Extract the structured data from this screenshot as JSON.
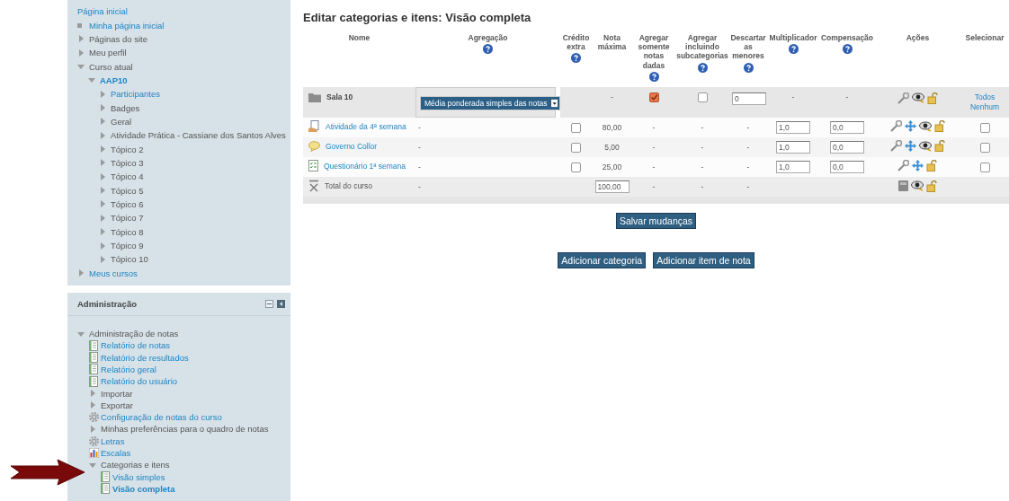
{
  "navigation": {
    "items": [
      {
        "label": "Página inicial",
        "kind": "root",
        "link": true
      },
      {
        "label": "Minha página inicial",
        "kind": "bullet",
        "link": true
      },
      {
        "label": "Páginas do site",
        "kind": "branch",
        "expanded": false,
        "link": false
      },
      {
        "label": "Meu perfil",
        "kind": "branch",
        "expanded": false,
        "link": false
      },
      {
        "label": "Curso atual",
        "kind": "branch",
        "expanded": true,
        "link": false,
        "children": [
          {
            "label": "AAP10",
            "kind": "branch",
            "expanded": true,
            "link": true,
            "bold": true,
            "children": [
              {
                "label": "Participantes",
                "kind": "branch",
                "expanded": false,
                "link": true
              },
              {
                "label": "Badges",
                "kind": "branch",
                "expanded": false,
                "link": false
              },
              {
                "label": "Geral",
                "kind": "branch",
                "expanded": false,
                "link": false
              },
              {
                "label": "Atividade Prática - Cassiane dos Santos Alves",
                "kind": "branch",
                "expanded": false,
                "link": false
              },
              {
                "label": "Tópico 2",
                "kind": "branch",
                "expanded": false,
                "link": false
              },
              {
                "label": "Tópico 3",
                "kind": "branch",
                "expanded": false,
                "link": false
              },
              {
                "label": "Tópico 4",
                "kind": "branch",
                "expanded": false,
                "link": false
              },
              {
                "label": "Tópico 5",
                "kind": "branch",
                "expanded": false,
                "link": false
              },
              {
                "label": "Tópico 6",
                "kind": "branch",
                "expanded": false,
                "link": false
              },
              {
                "label": "Tópico 7",
                "kind": "branch",
                "expanded": false,
                "link": false
              },
              {
                "label": "Tópico 8",
                "kind": "branch",
                "expanded": false,
                "link": false
              },
              {
                "label": "Tópico 9",
                "kind": "branch",
                "expanded": false,
                "link": false
              },
              {
                "label": "Tópico 10",
                "kind": "branch",
                "expanded": false,
                "link": false
              }
            ]
          }
        ]
      },
      {
        "label": "Meus cursos",
        "kind": "branch",
        "expanded": false,
        "link": true
      }
    ]
  },
  "administration": {
    "title": "Administração",
    "items": [
      {
        "label": "Administração de notas",
        "kind": "branch",
        "expanded": true,
        "link": false,
        "children": [
          {
            "label": "Relatório de notas",
            "kind": "report",
            "link": true
          },
          {
            "label": "Relatório de resultados",
            "kind": "report",
            "link": true
          },
          {
            "label": "Relatório geral",
            "kind": "report",
            "link": true
          },
          {
            "label": "Relatório do usuário",
            "kind": "report",
            "link": true
          },
          {
            "label": "Importar",
            "kind": "branch",
            "expanded": false,
            "link": false
          },
          {
            "label": "Exportar",
            "kind": "branch",
            "expanded": false,
            "link": false
          },
          {
            "label": "Configuração de notas do curso",
            "kind": "gear",
            "link": true
          },
          {
            "label": "Minhas preferências para o quadro de notas",
            "kind": "branch",
            "expanded": false,
            "link": false
          },
          {
            "label": "Letras",
            "kind": "gear",
            "link": true
          },
          {
            "label": "Escalas",
            "kind": "chart",
            "link": true
          },
          {
            "label": "Categorias e itens",
            "kind": "branch",
            "expanded": true,
            "link": false,
            "children": [
              {
                "label": "Visão simples",
                "kind": "report",
                "link": true
              },
              {
                "label": "Visão completa",
                "kind": "report",
                "link": true,
                "bold": true
              }
            ]
          }
        ]
      }
    ]
  },
  "page_title": "Editar categorias e itens: Visão completa",
  "table": {
    "columns": [
      {
        "label": "Nome",
        "help": false
      },
      {
        "label": "Agregação",
        "help": true
      },
      {
        "label": "Crédito extra",
        "help": true
      },
      {
        "label": "Nota máxima",
        "help": false
      },
      {
        "label": "Agregar somente notas dadas",
        "help": true
      },
      {
        "label": "Agregar incluindo subcategorias",
        "help": true
      },
      {
        "label": "Descartar as menores",
        "help": true
      },
      {
        "label": "Multiplicador",
        "help": true
      },
      {
        "label": "Compensação",
        "help": true
      },
      {
        "label": "Ações",
        "help": false
      },
      {
        "label": "Selecionar",
        "help": false
      }
    ],
    "rows": [
      {
        "kind": "category",
        "cells": [
          {
            "kind": "name",
            "text": "Sala 10",
            "link": false,
            "bold": true
          },
          {
            "kind": "select",
            "value": "Média ponderada simples das notas"
          },
          {
            "kind": "empty"
          },
          {
            "kind": "text",
            "text": "-"
          },
          {
            "kind": "checkbox",
            "checked": true
          },
          {
            "kind": "checkbox",
            "checked": false
          },
          {
            "kind": "input",
            "value": "0"
          },
          {
            "kind": "text",
            "text": "-"
          },
          {
            "kind": "text",
            "text": "-"
          },
          {
            "kind": "actions",
            "calculated": false,
            "movable": false,
            "hideable": true
          },
          {
            "kind": "links",
            "links": [
              "Todos",
              "Nenhum"
            ]
          }
        ]
      },
      {
        "kind": "assignment",
        "cells": [
          {
            "kind": "name",
            "text": "Atividade da 4ª semana",
            "link": true,
            "bold": false
          },
          {
            "kind": "text",
            "text": "-"
          },
          {
            "kind": "checkbox",
            "checked": false
          },
          {
            "kind": "text",
            "text": "80,00"
          },
          {
            "kind": "text",
            "text": "-"
          },
          {
            "kind": "text",
            "text": "-"
          },
          {
            "kind": "text",
            "text": "-"
          },
          {
            "kind": "input",
            "value": "1,0"
          },
          {
            "kind": "input",
            "value": "0,0"
          },
          {
            "kind": "actions",
            "calculated": false,
            "movable": true,
            "hideable": true
          },
          {
            "kind": "checkbox",
            "checked": false
          }
        ]
      },
      {
        "kind": "forum",
        "cells": [
          {
            "kind": "name",
            "text": "Governo Collor",
            "link": true,
            "bold": false
          },
          {
            "kind": "text",
            "text": "-"
          },
          {
            "kind": "checkbox",
            "checked": false
          },
          {
            "kind": "text",
            "text": "5,00"
          },
          {
            "kind": "text",
            "text": "-"
          },
          {
            "kind": "text",
            "text": "-"
          },
          {
            "kind": "text",
            "text": "-"
          },
          {
            "kind": "input",
            "value": "1,0"
          },
          {
            "kind": "input",
            "value": "0,0"
          },
          {
            "kind": "actions",
            "calculated": false,
            "movable": true,
            "hideable": true
          },
          {
            "kind": "checkbox",
            "checked": false
          }
        ]
      },
      {
        "kind": "quiz",
        "cells": [
          {
            "kind": "name",
            "text": "Questionário 1ª semana",
            "link": true,
            "bold": false
          },
          {
            "kind": "text",
            "text": "-"
          },
          {
            "kind": "checkbox",
            "checked": false
          },
          {
            "kind": "text",
            "text": "25,00"
          },
          {
            "kind": "text",
            "text": "-"
          },
          {
            "kind": "text",
            "text": "-"
          },
          {
            "kind": "text",
            "text": "-"
          },
          {
            "kind": "input",
            "value": "1,0"
          },
          {
            "kind": "input",
            "value": "0,0"
          },
          {
            "kind": "actions",
            "calculated": false,
            "movable": true,
            "hideable": false
          },
          {
            "kind": "checkbox",
            "checked": false
          }
        ]
      },
      {
        "kind": "total",
        "cells": [
          {
            "kind": "name",
            "text": "Total do curso",
            "link": false,
            "bold": false
          },
          {
            "kind": "text",
            "text": "-"
          },
          {
            "kind": "empty"
          },
          {
            "kind": "input",
            "value": "100,00"
          },
          {
            "kind": "text",
            "text": "-"
          },
          {
            "kind": "text",
            "text": "-"
          },
          {
            "kind": "text",
            "text": "-"
          },
          {
            "kind": "empty"
          },
          {
            "kind": "empty"
          },
          {
            "kind": "actions",
            "calculated": true,
            "movable": false,
            "hideable": true
          },
          {
            "kind": "empty"
          }
        ]
      }
    ]
  },
  "buttons": {
    "save": "Salvar mudanças",
    "add": [
      "Adicionar categoria",
      "Adicionar item de nota"
    ]
  }
}
